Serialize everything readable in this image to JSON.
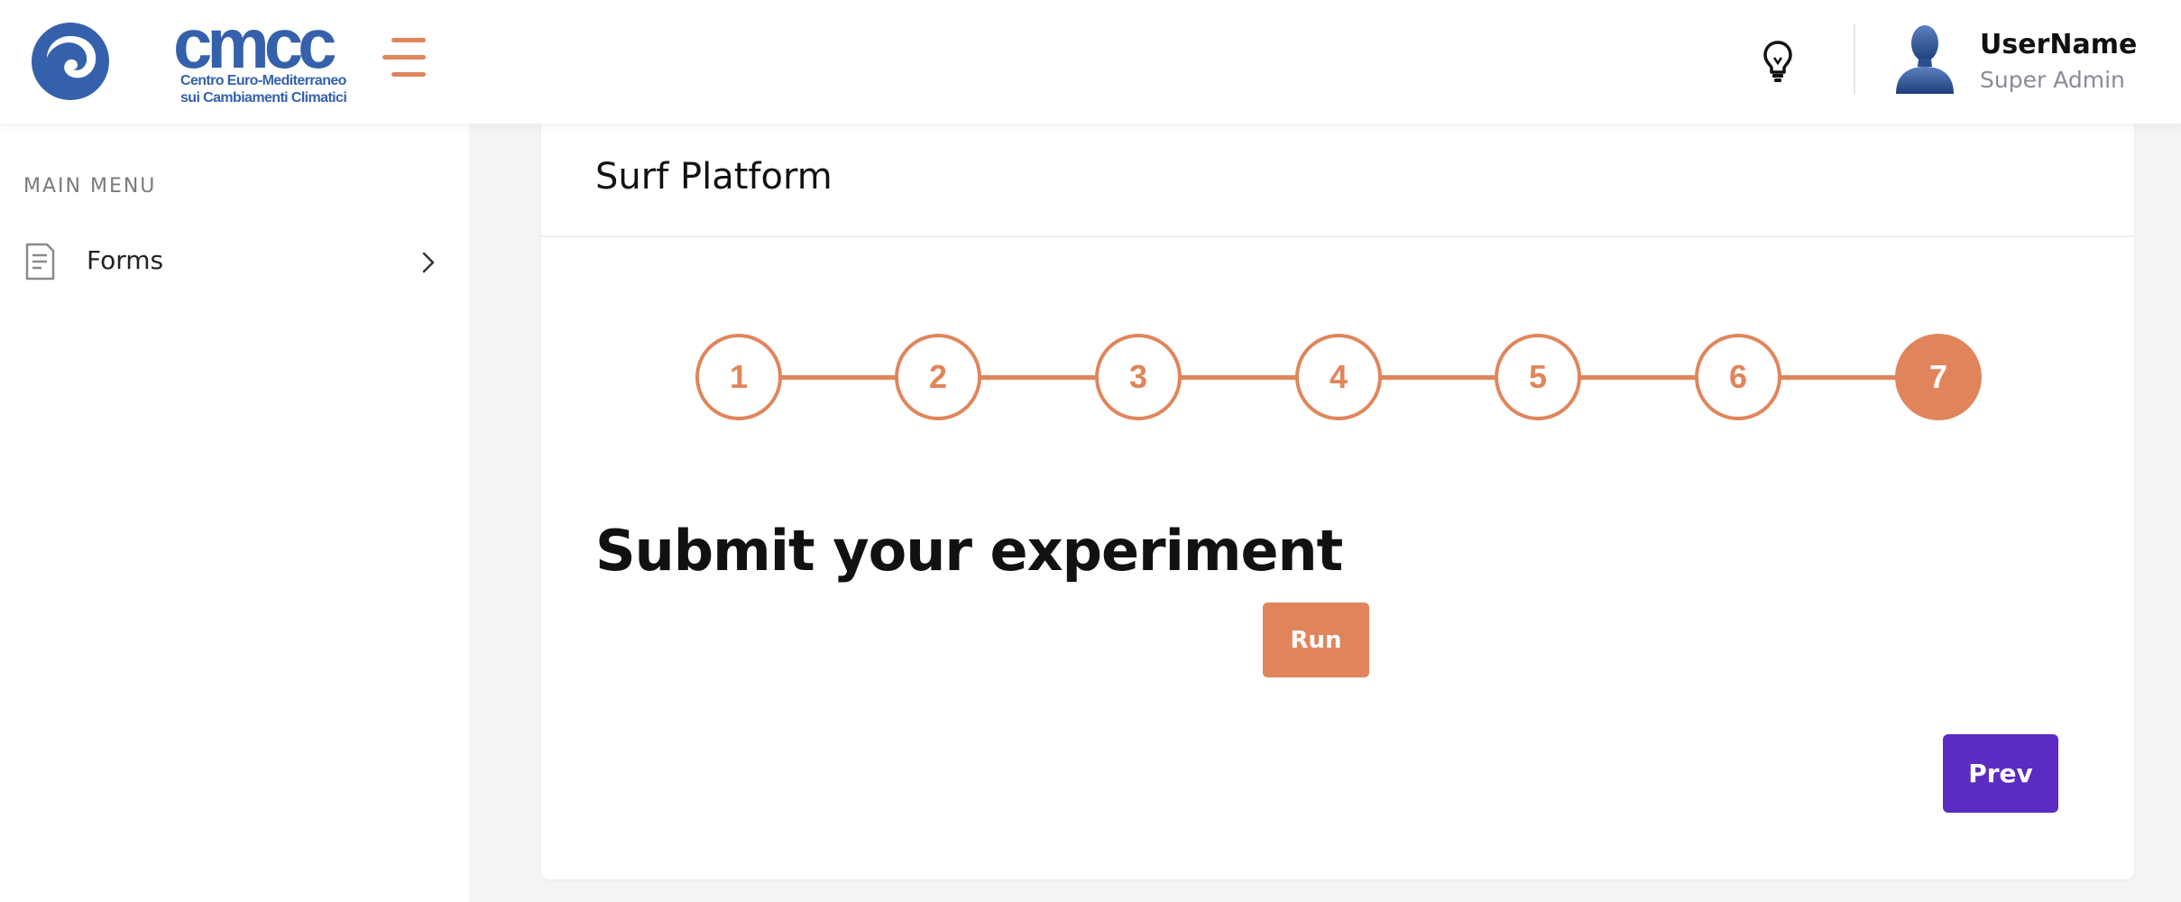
{
  "header": {
    "logo_wordmark": "cmcc",
    "logo_subtitle_line1": "Centro Euro-Mediterraneo",
    "logo_subtitle_line2": "sui Cambiamenti Climatici",
    "brand_color": "#3561ac",
    "accent_color": "#e0855b",
    "user": {
      "name": "UserName",
      "role": "Super Admin"
    }
  },
  "sidebar": {
    "heading": "MAIN MENU",
    "items": [
      {
        "label": "Forms",
        "icon": "document-icon",
        "trailing_icon": "chevron-right-icon"
      }
    ]
  },
  "main": {
    "card_title": "Surf Platform",
    "stepper": {
      "steps": [
        "1",
        "2",
        "3",
        "4",
        "5",
        "6",
        "7"
      ],
      "active_step": "7"
    },
    "section_title": "Submit your experiment",
    "run_label": "Run",
    "prev_label": "Prev",
    "prev_color": "#5b2bc2"
  }
}
